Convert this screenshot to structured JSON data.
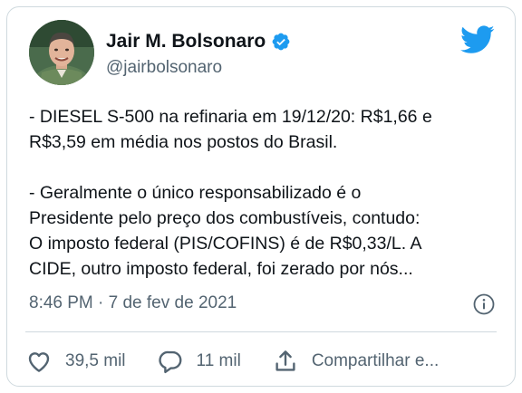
{
  "author": {
    "display_name": "Jair M. Bolsonaro",
    "handle": "@jairbolsonaro",
    "verified": true,
    "avatar_icon": "profile-photo"
  },
  "brand": {
    "logo_icon": "twitter-bird-icon",
    "color": "#1d9bf0"
  },
  "tweet": {
    "paragraph_1": "- DIESEL S-500 na refinaria em 19/12/20: R$1,66 e\nR$3,59 em média nos postos do Brasil.",
    "paragraph_2": "- Geralmente o único responsabilizado é o\nPresidente pelo preço dos combustíveis, contudo:\nO imposto federal (PIS/COFINS) é de R$0,33/L. A\nCIDE, outro imposto federal, foi zerado por nós..."
  },
  "meta": {
    "timestamp": "8:46 PM · 7 de fev de 2021",
    "info_icon": "info-icon"
  },
  "actions": {
    "like_count": "39,5 mil",
    "reply_count": "11 mil",
    "share_label": "Compartilhar e..."
  },
  "colors": {
    "text_primary": "#0f1419",
    "text_secondary": "#536471",
    "border": "#cfd9de"
  }
}
